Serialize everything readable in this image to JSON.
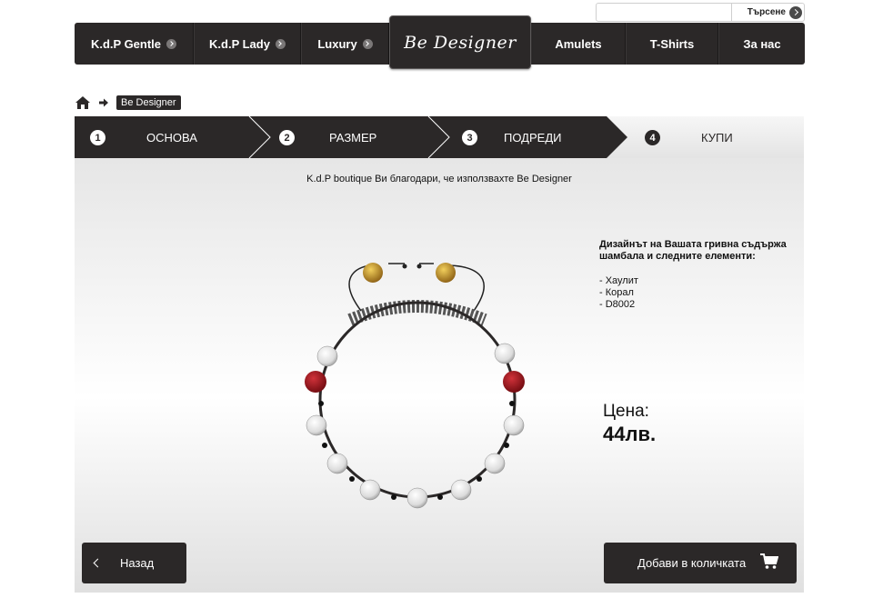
{
  "search": {
    "placeholder": "",
    "button_label": "Търсене"
  },
  "nav": {
    "items": [
      {
        "label": "K.d.P Gentle"
      },
      {
        "label": "K.d.P Lady"
      },
      {
        "label": "Luxury"
      },
      {
        "label": "Amulets"
      },
      {
        "label": "T-Shirts"
      },
      {
        "label": "За нас"
      }
    ],
    "featured_label": "Be Designer"
  },
  "breadcrumb": {
    "current": "Be Designer"
  },
  "steps": [
    {
      "number": "1",
      "label": "ОСНОВА"
    },
    {
      "number": "2",
      "label": "РАЗМЕР"
    },
    {
      "number": "3",
      "label": "ПОДРЕДИ"
    },
    {
      "number": "4",
      "label": "КУПИ"
    }
  ],
  "main": {
    "thanks_text": "K.d.P boutique Ви благодари, че използвахте Be Designer",
    "description_title": "Дизайнът на Вашата гривна съдържа шамбала и следните елементи:",
    "elements": [
      "- Хаулит",
      "- Корал",
      "- D8002"
    ],
    "price_label": "Цена:",
    "price_value": "44лв."
  },
  "buttons": {
    "back": "Назад",
    "add_to_cart": "Добави в количката"
  },
  "colors": {
    "dark": "#2b2828",
    "coral": "#a8141a",
    "gold": "#c9952a",
    "howlite": "#e8e8e8"
  },
  "icons": [
    "home-icon",
    "arrow-right-icon",
    "cart-icon",
    "chevron-left-icon",
    "arrow-circle-icon"
  ]
}
